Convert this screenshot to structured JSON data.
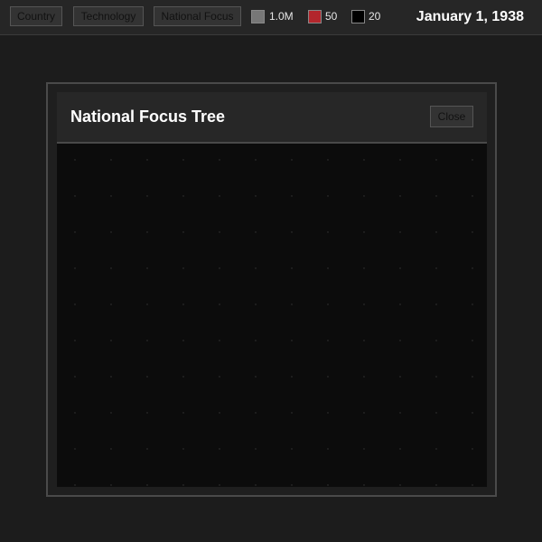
{
  "topbar": {
    "tabs": [
      {
        "label": "Country"
      },
      {
        "label": "Technology"
      },
      {
        "label": "National Focus"
      }
    ],
    "resources": [
      {
        "value": "1.0M",
        "color": "#777777",
        "icon": "manpower-icon"
      },
      {
        "value": "50",
        "color": "#b3262c",
        "icon": "resource-icon"
      },
      {
        "value": "20",
        "color": "#000000",
        "icon": "resource-icon"
      }
    ],
    "date": "January 1, 1938"
  },
  "focus_modal": {
    "title": "National Focus Tree",
    "close_label": "Close"
  }
}
